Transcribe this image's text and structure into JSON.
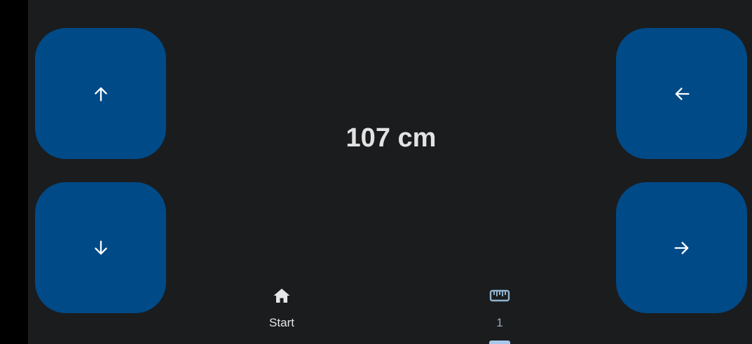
{
  "app": {
    "background": "#1b1c1e",
    "accent": "#004a87"
  },
  "controls": {
    "up": {
      "icon": "arrow-up-icon"
    },
    "down": {
      "icon": "arrow-down-icon"
    },
    "left": {
      "icon": "arrow-left-icon"
    },
    "right": {
      "icon": "arrow-right-icon"
    }
  },
  "readout": {
    "value": "107 cm"
  },
  "bottom_nav": {
    "items": [
      {
        "label": "Start",
        "icon": "home-icon",
        "selected": false
      },
      {
        "label": "1",
        "icon": "ruler-icon",
        "selected": true
      }
    ]
  }
}
